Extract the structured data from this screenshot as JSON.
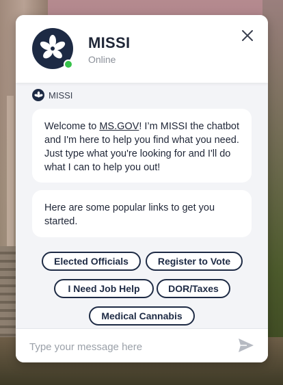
{
  "header": {
    "bot_name": "MISSI",
    "status": "Online"
  },
  "message_sender": "MISSI",
  "messages": [
    {
      "before_link": "Welcome to ",
      "link": "MS.GOV",
      "after_link": "! I’m MISSI the chatbot and I'm here to help you find what you need. Just type what you're looking for and I'll do what I can to help you out!"
    },
    {
      "text": "Here are some popular links to get you started."
    }
  ],
  "quick_links": [
    "Elected Officials",
    "Register to Vote",
    "I Need Job Help",
    "DOR/Taxes",
    "Medical Cannabis"
  ],
  "input": {
    "value": "",
    "placeholder": "Type your message here"
  },
  "colors": {
    "brand_navy": "#1d2a44",
    "online_green": "#37c24a",
    "panel_bg": "#f3f4f7"
  },
  "icons": {
    "avatar": "magnolia-icon",
    "close": "close-icon",
    "send": "send-icon"
  }
}
